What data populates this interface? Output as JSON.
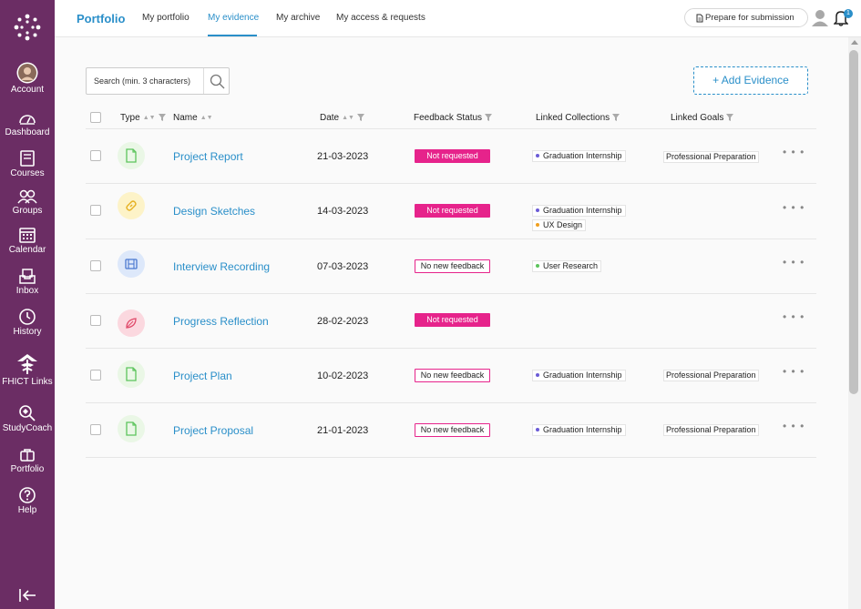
{
  "sidebar": {
    "items": [
      {
        "label": "Account",
        "icon": "avatar"
      },
      {
        "label": "Dashboard",
        "icon": "dashboard-icon"
      },
      {
        "label": "Courses",
        "icon": "courses-icon"
      },
      {
        "label": "Groups",
        "icon": "groups-icon"
      },
      {
        "label": "Calendar",
        "icon": "calendar-icon"
      },
      {
        "label": "Inbox",
        "icon": "inbox-icon"
      },
      {
        "label": "History",
        "icon": "history-icon"
      },
      {
        "label": "FHICT Links",
        "icon": "links-icon"
      },
      {
        "label": "StudyCoach",
        "icon": "studycoach-icon"
      },
      {
        "label": "Portfolio",
        "icon": "portfolio-icon"
      },
      {
        "label": "Help",
        "icon": "help-icon"
      }
    ],
    "color": "#6b2d64"
  },
  "header": {
    "brand": "Portfolio",
    "tabs": [
      {
        "label": "My portfolio"
      },
      {
        "label": "My evidence",
        "active": true
      },
      {
        "label": "My archive"
      },
      {
        "label": "My access & requests"
      }
    ],
    "prepare_label": "Prepare for submission",
    "notification_count": "1"
  },
  "toolbar": {
    "search_placeholder": "Search (min. 3 characters)",
    "add_label": "+ Add Evidence"
  },
  "table": {
    "columns": [
      "Type",
      "Name",
      "Date",
      "Feedback Status",
      "Linked Collections",
      "Linked Goals"
    ],
    "rows": [
      {
        "type": "document",
        "name": "Project Report",
        "date": "21-03-2023",
        "status": "Not requested",
        "collections": [
          "Graduation Internship"
        ],
        "goal": "Professional Preparation"
      },
      {
        "type": "link",
        "name": "Design Sketches",
        "date": "14-03-2023",
        "status": "Not requested",
        "collections": [
          "Graduation Internship",
          "UX Design"
        ],
        "goal": ""
      },
      {
        "type": "video",
        "name": "Interview Recording",
        "date": "07-03-2023",
        "status": "No new feedback",
        "collections": [
          "User Research"
        ],
        "goal": ""
      },
      {
        "type": "reflection",
        "name": "Progress Reflection",
        "date": "28-02-2023",
        "status": "Not requested",
        "collections": [],
        "goal": ""
      },
      {
        "type": "document",
        "name": "Project Plan",
        "date": "10-02-2023",
        "status": "No new feedback",
        "collections": [
          "Graduation Internship"
        ],
        "goal": "Professional Preparation"
      },
      {
        "type": "document",
        "name": "Project Proposal",
        "date": "21-01-2023",
        "status": "No new feedback",
        "collections": [
          "Graduation Internship"
        ],
        "goal": "Professional Preparation"
      }
    ]
  },
  "colors": {
    "accent": "#2a8fc9",
    "status_pink": "#e6238b",
    "collection_dot_purple": "#6b5bd6",
    "collection_dot_orange": "#f0a020",
    "collection_dot_green": "#5cc45c"
  },
  "more_glyph": "• • •"
}
